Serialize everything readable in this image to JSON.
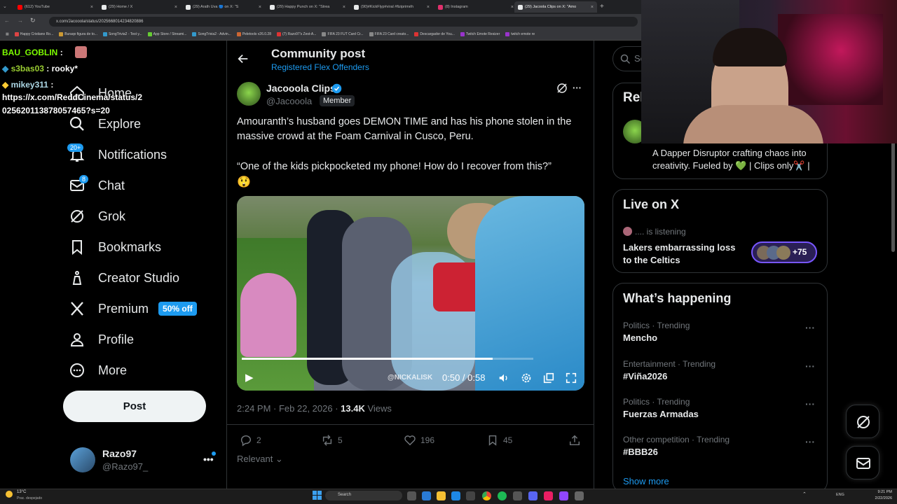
{
  "browser": {
    "tabs": [
      {
        "label": "(612) YouTube",
        "color": "#ff0000"
      },
      {
        "label": "(29) Home / X",
        "color": "#e7e9ea"
      },
      {
        "label": "(29) Arath Uva 🔵 on X: \"S",
        "color": "#e7e9ea"
      },
      {
        "label": "(29) Happy Punch on X: \"Strea",
        "color": "#e7e9ea"
      },
      {
        "label": "(90)#KickFlyp#viral #fizipriméh",
        "color": "#e7e9ea"
      },
      {
        "label": "(8) Instagram",
        "color": "#e1306c"
      },
      {
        "label": "(29) Jacoola Clips on X: \"Amo",
        "color": "#e7e9ea"
      }
    ],
    "url": "x.com/Jacooola/status/2025668014234820886",
    "bookmarks": [
      "Happy Cristiano Ro...",
      "Buraqo figura de to...",
      "SongTrivia2 - Test y...",
      "App Store / Streami...",
      "SongTrivia2 - Advin...",
      "Peletools v26.0.28",
      "(7) Razo97's Zest-A...",
      "FIFA 23 FUT Card Cr...",
      "FIFA 23 Card creato...",
      "Descargador de You...",
      "Twitch Emote Resizer",
      "twitch emote re"
    ]
  },
  "chat": [
    {
      "user": "BAU_GOBLIN",
      "color": "#7cfc00",
      "msg": ":"
    },
    {
      "user": "s3bas03",
      "color": "#9acd32",
      "msg": ": rooky*"
    },
    {
      "user": "mikey311",
      "color": "#add8e6",
      "msg": ":"
    },
    {
      "user": "",
      "color": "#ffffff",
      "msg": "https://x.com/ReddCinema/status/2"
    },
    {
      "user": "",
      "color": "#ffffff",
      "msg": "025620113878057465?s=20"
    }
  ],
  "sidebar": {
    "items": [
      {
        "label": "Home",
        "icon": "home-icon"
      },
      {
        "label": "Explore",
        "icon": "search-icon"
      },
      {
        "label": "Notifications",
        "icon": "bell-icon",
        "badge": "20+"
      },
      {
        "label": "Chat",
        "icon": "mail-icon",
        "badge": "8"
      },
      {
        "label": "Grok",
        "icon": "grok-icon"
      },
      {
        "label": "Bookmarks",
        "icon": "bookmark-icon"
      },
      {
        "label": "Creator Studio",
        "icon": "creator-icon"
      },
      {
        "label": "Premium",
        "icon": "x-logo-icon",
        "badge": "50% off"
      },
      {
        "label": "Profile",
        "icon": "person-icon"
      },
      {
        "label": "More",
        "icon": "more-circle-icon"
      }
    ],
    "post_button": "Post",
    "account": {
      "name": "Razo97",
      "handle": "@Razo97_"
    }
  },
  "post": {
    "header_title": "Community post",
    "community": "Registered Flex Offenders",
    "author_name": "Jacooola Clips",
    "author_handle": "@Jacooola",
    "member_badge": "Member",
    "text1": "Amouranth’s husband goes DEMON TIME and has his phone stolen in the massive crowd at the Foam Carnival in Cusco, Peru.",
    "text2": "“One of the kids pickpocketed my phone! How do I recover from this?”",
    "emoji": "😲",
    "video_time": "0:50 / 0:58",
    "video_progress": 0.86,
    "video_watermark": "@NICKALISK",
    "timestamp": "2:24 PM · Feb 22, 2026 · ",
    "views_count": "13.4K",
    "views_label": " Views",
    "replies": "2",
    "reposts": "5",
    "likes": "196",
    "bookmarks": "45",
    "sort": "Relevant"
  },
  "right": {
    "search_placeholder": "Se",
    "relevant_title": "Rel",
    "relevant_bio": "A Dapper Disruptor crafting chaos into creativity. Fueled by 💚 | Clips only✂️ |",
    "live_title": "Live on X",
    "live_listening": ".... is listening",
    "live_topic": "Lakers embarrassing loss to the Celtics",
    "live_count": "+75",
    "happening_title": "What’s happening",
    "trends": [
      {
        "category": "Politics · Trending",
        "name": "Mencho"
      },
      {
        "category": "Entertainment · Trending",
        "name": "#Viña2026"
      },
      {
        "category": "Politics · Trending",
        "name": "Fuerzas Armadas"
      },
      {
        "category": "Other competition · Trending",
        "name": "#BBB26"
      }
    ],
    "show_more": "Show more"
  },
  "taskbar": {
    "weather_temp": "13°C",
    "weather_desc": "Prac. despejado",
    "search": "Search",
    "lang": "ENG",
    "time": "9:21 PM",
    "date": "2/22/2026"
  },
  "colors": {
    "accent": "#1d9bf0",
    "bg": "#000000",
    "border": "#2f3336",
    "muted": "#71767b"
  }
}
